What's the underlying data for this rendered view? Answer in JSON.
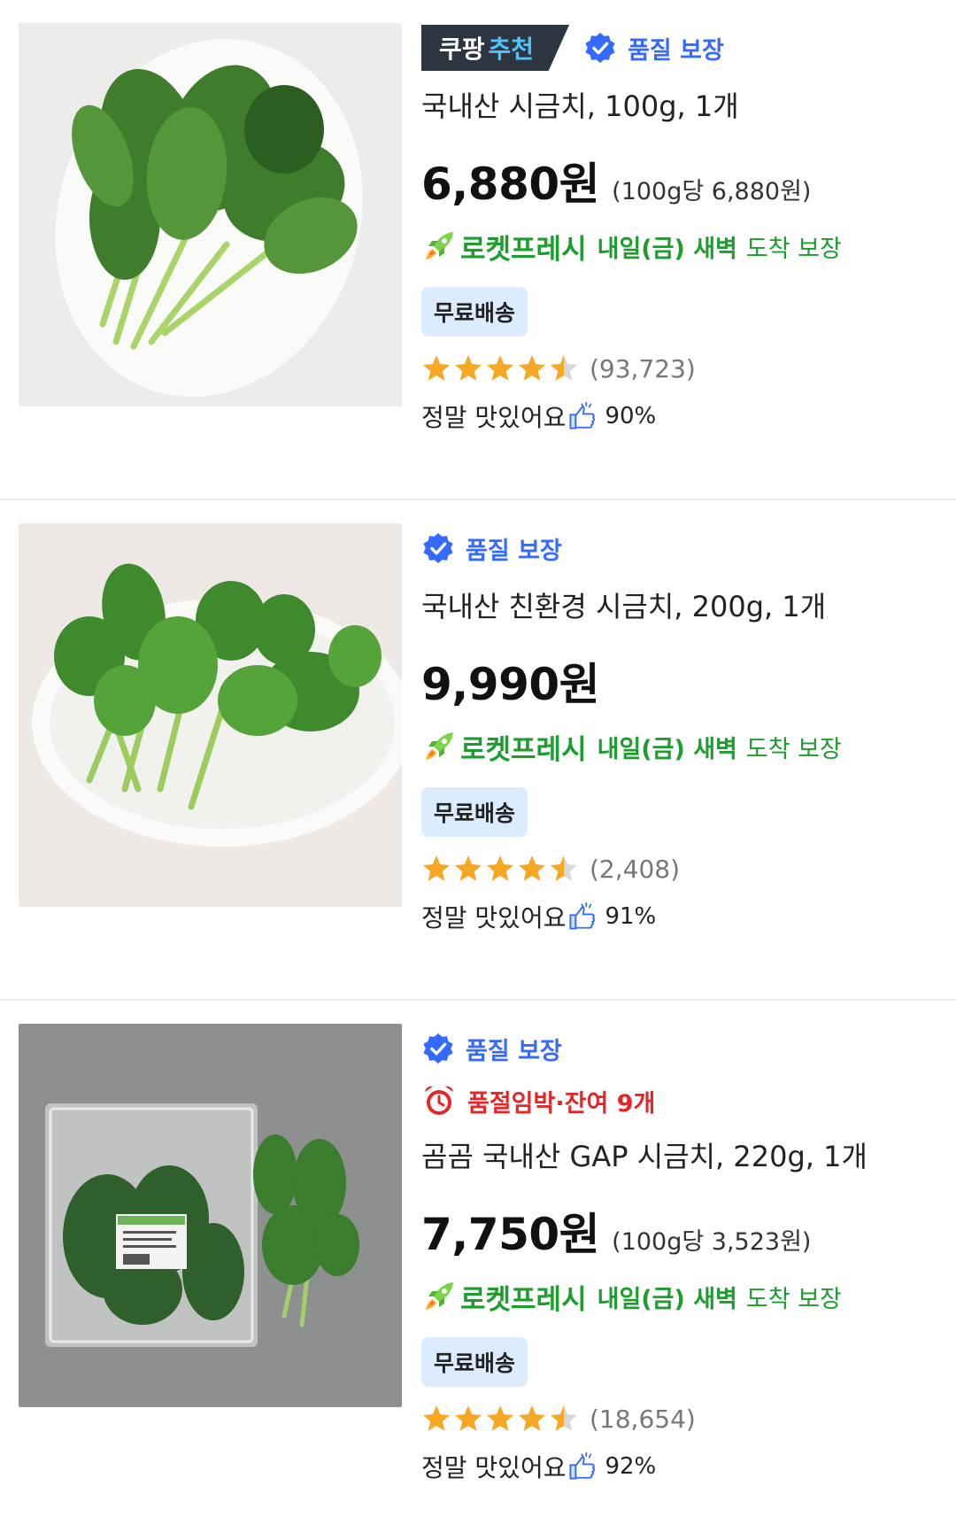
{
  "items": [
    {
      "rec_label_a": "쿠팡",
      "rec_label_b": "추천",
      "quality_label": "품질 보장",
      "title": "국내산 시금치, 100g, 1개",
      "price": "6,880원",
      "unit_price": "(100g당 6,880원)",
      "rocket_brand": "로켓프레시",
      "delivery_day": "내일(금) 새벽",
      "delivery_rest": "도착 보장",
      "free_shipping": "무료배송",
      "rating": 4.5,
      "review_count": "(93,723)",
      "taste_label": "정말 맛있어요",
      "taste_pct": "90%"
    },
    {
      "quality_label": "품질 보장",
      "title": "국내산 친환경 시금치, 200g, 1개",
      "price": "9,990원",
      "rocket_brand": "로켓프레시",
      "delivery_day": "내일(금) 새벽",
      "delivery_rest": "도착 보장",
      "free_shipping": "무료배송",
      "rating": 4.5,
      "review_count": "(2,408)",
      "taste_label": "정말 맛있어요",
      "taste_pct": "91%"
    },
    {
      "quality_label": "품질 보장",
      "soldout_label": "품절임박·잔여 9개",
      "title": "곰곰 국내산 GAP 시금치, 220g, 1개",
      "price": "7,750원",
      "unit_price": "(100g당 3,523원)",
      "rocket_brand": "로켓프레시",
      "delivery_day": "내일(금) 새벽",
      "delivery_rest": "도착 보장",
      "free_shipping": "무료배송",
      "rating": 4.5,
      "review_count": "(18,654)",
      "taste_label": "정말 맛있어요",
      "taste_pct": "92%"
    }
  ],
  "colors": {
    "quality_blue": "#346aff",
    "rocket_green": "#1c9d2e",
    "soldout_red": "#e52528",
    "star": "#f6a723",
    "free_bg": "#dcecff"
  }
}
